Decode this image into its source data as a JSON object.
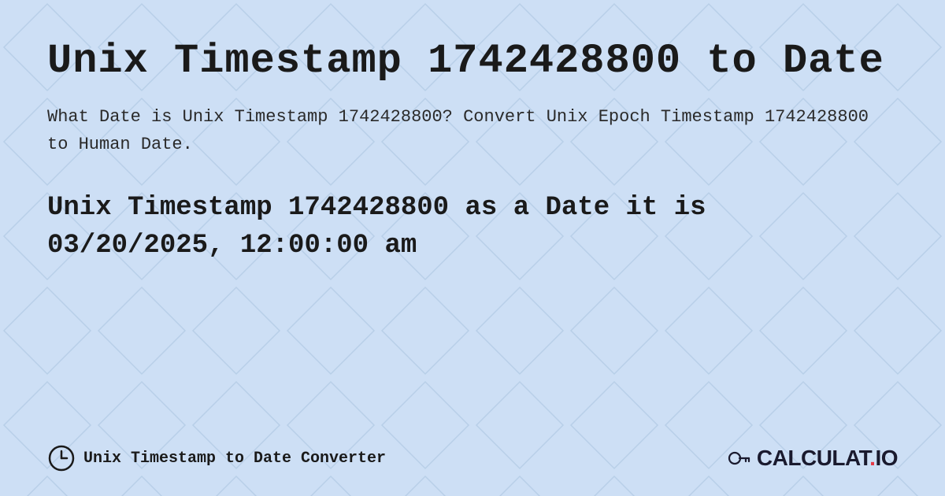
{
  "page": {
    "title": "Unix Timestamp 1742428800 to Date",
    "description": "What Date is Unix Timestamp 1742428800? Convert Unix Epoch Timestamp 1742428800 to Human Date.",
    "result_line1": "Unix Timestamp 1742428800 as a Date it is",
    "result_line2": "03/20/2025, 12:00:00 am",
    "footer_label": "Unix Timestamp to Date Converter",
    "logo_text": "CALCULAT.IO",
    "bg_color": "#c8daf0",
    "diamond_color": "#b8cfe8",
    "diamond_stroke": "#a8bfd8"
  }
}
